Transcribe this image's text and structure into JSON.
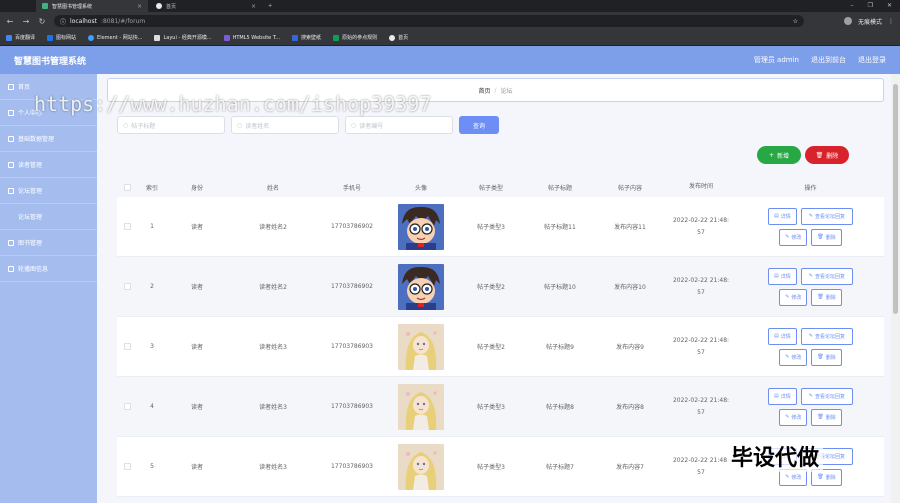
{
  "browser": {
    "tabs": [
      {
        "label": "智慧图书管理系统",
        "active": true
      },
      {
        "label": "首页",
        "active": false
      }
    ],
    "url_host": "localhost",
    "url_rest": ":8081/#/forum",
    "profile_label": "无痕模式",
    "bookmarks": [
      "百度翻译",
      "图标网站",
      "Element - 网站快...",
      "Layui - 经典开源模...",
      "HTML5 Website T...",
      "搜索壁纸",
      "原始的参点规则",
      "首页"
    ]
  },
  "app": {
    "title": "智慧图书管理系统",
    "nav_links": [
      "管理员 admin",
      "退出到前台",
      "退出登录"
    ]
  },
  "sidebar": {
    "items": [
      {
        "label": "首页",
        "sub": false
      },
      {
        "label": "个人中心",
        "sub": false
      },
      {
        "label": "基础数据管理",
        "sub": false
      },
      {
        "label": "读者管理",
        "sub": false
      },
      {
        "label": "论坛管理",
        "sub": false
      },
      {
        "label": "论坛管理",
        "sub": true
      },
      {
        "label": "图书管理",
        "sub": false
      },
      {
        "label": "轮播图信息",
        "sub": false
      }
    ]
  },
  "breadcrumb": {
    "home": "首页",
    "sep": "/",
    "current": "论坛"
  },
  "search": {
    "title_placeholder": "帖子标题",
    "user_placeholder": "读者姓名",
    "phone_placeholder": "读者编号",
    "button": "查询"
  },
  "actions": {
    "add": "新增",
    "delete": "删除"
  },
  "table": {
    "headers": [
      "索引",
      "身份",
      "姓名",
      "手机号",
      "头像",
      "帖子类型",
      "帖子标题",
      "帖子内容",
      "发布时间",
      "操作"
    ],
    "ops": {
      "detail": "详情",
      "reply": "查看论坛回复",
      "edit": "修改",
      "delete": "删除"
    },
    "rows": [
      {
        "idx": "1",
        "role": "读者",
        "name": "读者姓名2",
        "phone": "17703786902",
        "avatar": "conan",
        "type": "帖子类型3",
        "title": "帖子标题11",
        "content": "发布内容11",
        "time1": "2022-02-22 21:48:",
        "time2": "57"
      },
      {
        "idx": "2",
        "role": "读者",
        "name": "读者姓名2",
        "phone": "17703786902",
        "avatar": "conan",
        "type": "帖子类型2",
        "title": "帖子标题10",
        "content": "发布内容10",
        "time1": "2022-02-22 21:48:",
        "time2": "57"
      },
      {
        "idx": "3",
        "role": "读者",
        "name": "读者姓名3",
        "phone": "17703786903",
        "avatar": "girl",
        "type": "帖子类型2",
        "title": "帖子标题9",
        "content": "发布内容9",
        "time1": "2022-02-22 21:48:",
        "time2": "57"
      },
      {
        "idx": "4",
        "role": "读者",
        "name": "读者姓名3",
        "phone": "17703786903",
        "avatar": "girl",
        "type": "帖子类型3",
        "title": "帖子标题8",
        "content": "发布内容8",
        "time1": "2022-02-22 21:48:",
        "time2": "57"
      },
      {
        "idx": "5",
        "role": "读者",
        "name": "读者姓名3",
        "phone": "17703786903",
        "avatar": "girl",
        "type": "帖子类型3",
        "title": "帖子标题7",
        "content": "发布内容7",
        "time1": "2022-02-22 21:48:",
        "time2": "57"
      }
    ]
  },
  "overlays": {
    "watermark": "https://www.huzhan.com/ishop39397",
    "stamp": "毕设代做"
  },
  "colors": {
    "topnav": "#7d9ee8",
    "sidebar": "#a4bdee",
    "primary": "#6c8ef5",
    "success": "#28a745",
    "danger": "#d9232c"
  }
}
